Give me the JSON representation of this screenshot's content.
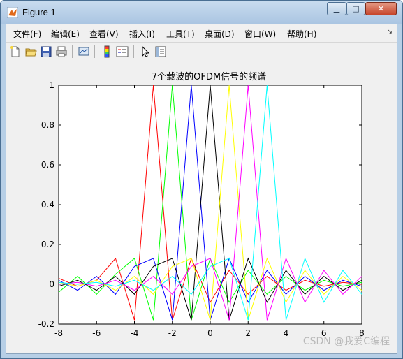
{
  "window": {
    "title": "Figure 1",
    "controls": {
      "minimize": "▁",
      "maximize": "□",
      "close": "✕"
    }
  },
  "menubar": {
    "items": [
      {
        "label": "文件(F)"
      },
      {
        "label": "编辑(E)"
      },
      {
        "label": "查看(V)"
      },
      {
        "label": "插入(I)"
      },
      {
        "label": "工具(T)"
      },
      {
        "label": "桌面(D)"
      },
      {
        "label": "窗口(W)"
      },
      {
        "label": "帮助(H)"
      }
    ],
    "overflow_arrow": "↘"
  },
  "toolbar": {
    "icons": [
      "new-figure-icon",
      "open-file-icon",
      "save-icon",
      "print-icon",
      "link-plot-icon",
      "colorbar-icon",
      "legend-icon",
      "pointer-icon",
      "property-editor-icon"
    ]
  },
  "watermark": "CSDN @我爱C编程",
  "chart_data": {
    "type": "line",
    "title": "7个载波的OFDM信号的频谱",
    "xlabel": "",
    "ylabel": "",
    "xlim": [
      -8,
      8
    ],
    "ylim": [
      -0.2,
      1
    ],
    "xticks": [
      "-8",
      "-6",
      "-4",
      "-2",
      "0",
      "2",
      "4",
      "6",
      "8"
    ],
    "yticks": [
      "-0.2",
      "0",
      "0.2",
      "0.4",
      "0.6",
      "0.8",
      "1"
    ],
    "grid": false,
    "x": [
      -8,
      -7,
      -6,
      -5,
      -4,
      -3,
      -2,
      -1,
      0,
      1,
      2,
      3,
      4,
      5,
      6,
      7,
      8
    ],
    "series": [
      {
        "color": "#ff0000",
        "values": [
          0.03,
          -0.01,
          0.02,
          0.13,
          -0.18,
          1,
          -0.18,
          0.13,
          -0.09,
          0.07,
          -0.05,
          0.04,
          -0.03,
          0.02,
          -0.01,
          0.01,
          0.0
        ]
      },
      {
        "color": "#00ff00",
        "values": [
          -0.04,
          0.04,
          -0.05,
          0.05,
          0.13,
          -0.18,
          1,
          -0.18,
          0.13,
          -0.09,
          0.07,
          -0.05,
          0.04,
          -0.03,
          0.02,
          -0.01,
          0.01
        ]
      },
      {
        "color": "#0000ff",
        "values": [
          0.02,
          -0.03,
          0.04,
          -0.05,
          0.09,
          0.13,
          -0.18,
          1,
          -0.18,
          0.13,
          -0.09,
          0.07,
          -0.05,
          0.04,
          -0.03,
          0.02,
          -0.01
        ]
      },
      {
        "color": "#000000",
        "values": [
          -0.01,
          0.02,
          -0.03,
          0.04,
          -0.05,
          0.09,
          0.13,
          -0.18,
          1,
          -0.18,
          0.13,
          -0.09,
          0.07,
          -0.05,
          0.04,
          -0.03,
          0.02
        ]
      },
      {
        "color": "#ffff00",
        "values": [
          0.01,
          -0.01,
          0.02,
          -0.03,
          0.04,
          -0.05,
          0.09,
          0.13,
          -0.18,
          1,
          -0.18,
          0.13,
          -0.09,
          0.07,
          -0.05,
          0.04,
          -0.03
        ]
      },
      {
        "color": "#ff00ff",
        "values": [
          0.0,
          0.01,
          -0.01,
          0.02,
          -0.03,
          0.04,
          -0.05,
          0.09,
          0.13,
          -0.18,
          1,
          -0.18,
          0.13,
          -0.09,
          0.07,
          -0.05,
          0.04
        ]
      },
      {
        "color": "#00ffff",
        "values": [
          0.01,
          0.0,
          0.01,
          -0.01,
          0.02,
          -0.03,
          0.04,
          -0.05,
          0.09,
          0.13,
          -0.18,
          1,
          -0.18,
          0.13,
          -0.09,
          0.07,
          -0.05
        ]
      }
    ]
  }
}
